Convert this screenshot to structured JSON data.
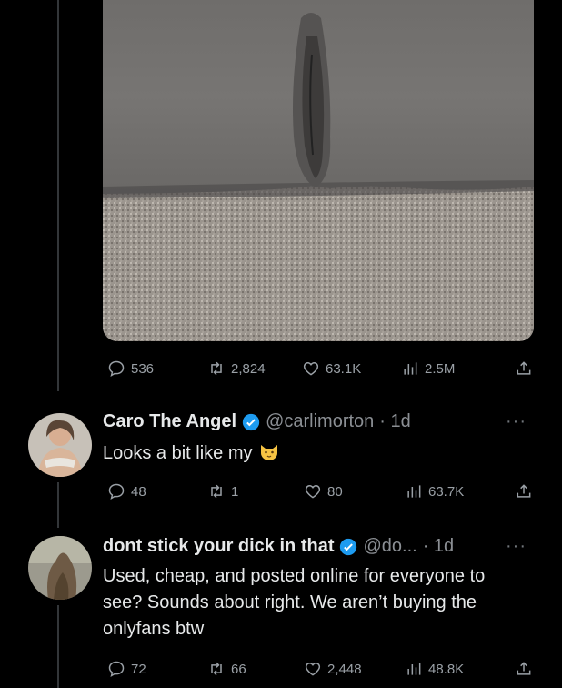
{
  "post": {
    "media": {
      "alt": ""
    },
    "stats": {
      "replies": "536",
      "reposts": "2,824",
      "likes": "63.1K",
      "views": "2.5M"
    }
  },
  "replies": [
    {
      "name": "Caro The Angel",
      "handle": "@carlimorton",
      "time": "· 1d",
      "text": "Looks a bit like my",
      "emoji": "cat-face-emoji",
      "stats": {
        "replies": "48",
        "reposts": "1",
        "likes": "80",
        "views": "63.7K"
      }
    },
    {
      "name": "dont stick your dick in that",
      "handle": "@do...",
      "time": "· 1d",
      "text": "Used, cheap, and posted online for everyone to see? Sounds about right. We aren’t buying the onlyfans btw",
      "stats": {
        "replies": "72",
        "reposts": "66",
        "likes": "2,448",
        "views": "48.8K"
      }
    }
  ],
  "more_label": "···",
  "colors": {
    "background": "#000000",
    "text": "#e7e9ea",
    "muted": "#71767b",
    "verified": "#1d9bf0"
  }
}
